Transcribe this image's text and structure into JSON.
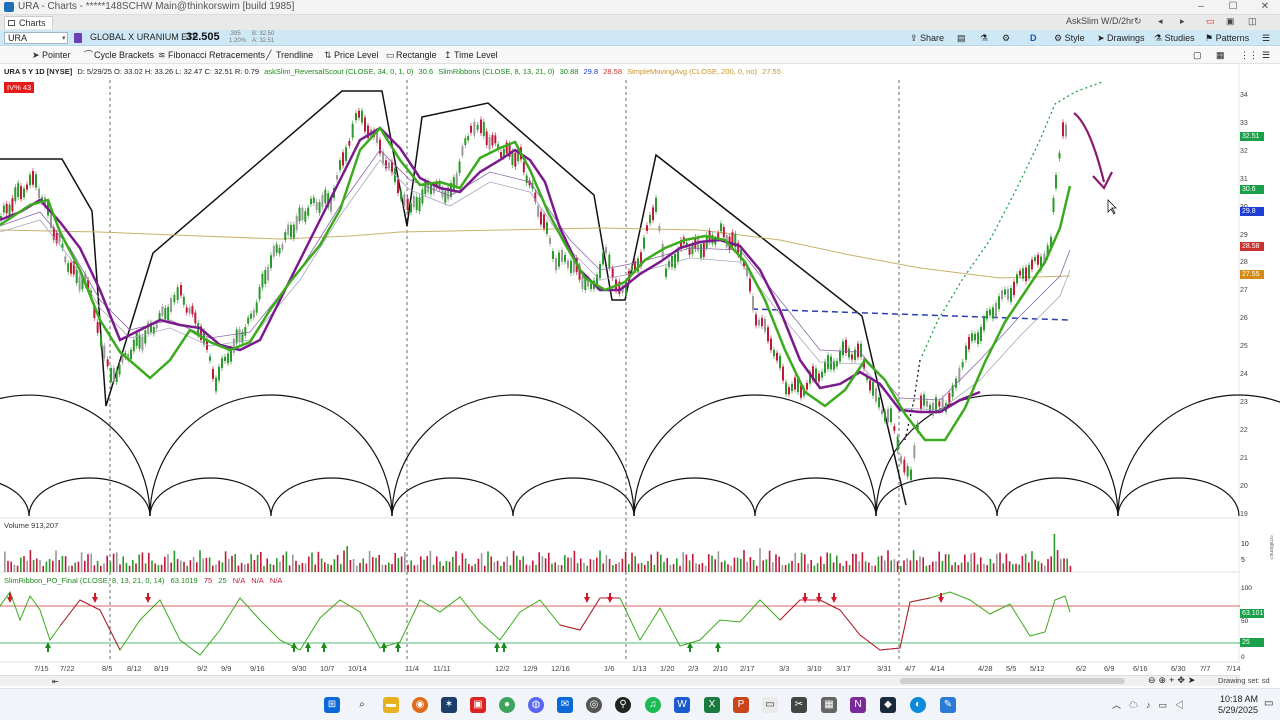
{
  "window": {
    "title": "URA - Charts - *****148SCHW Main@thinkorswim [build 1985]",
    "tab_label": "Charts",
    "right_account": "AskSlim W/D/2hr"
  },
  "symbol_bar": {
    "symbol": "URA",
    "description": "GLOBAL X URANIUM ETF",
    "last_price": "32.505",
    "change": ".395",
    "change_pct": "1.20%",
    "bid": "B: 32.50",
    "ask": "A: 32.51",
    "buttons": [
      "Share",
      "D",
      "Style",
      "Drawings",
      "Studies",
      "Patterns"
    ]
  },
  "toolbar": {
    "tools": [
      "Pointer",
      "Cycle Brackets",
      "Fibonacci Retracements",
      "Trendline",
      "Price Level",
      "Rectangle",
      "Time Level"
    ]
  },
  "study_header": {
    "symbol_info": "URA 5 Y 1D [NYSE]",
    "ohlc": "D: 5/29/25 O: 33.02 H: 33.26 L: 32.47 C: 32.51 R: 0.79",
    "study1": "askSlim_ReversalScout (CLOSE, 34, 0, 1, 0)",
    "study1_val": "30.6",
    "study2": "SlimRibbons (CLOSE, 8, 13, 21, 0)",
    "study2_vals": [
      "30.88",
      "29.8",
      "28.58"
    ],
    "study3": "SimpleMovingAvg (CLOSE, 200, 0, no)",
    "study3_val": "27.55",
    "iv_badge": "IV% 43"
  },
  "price_axis": {
    "ticks": [
      "34",
      "33",
      "32",
      "31",
      "30",
      "29",
      "28",
      "27",
      "26",
      "25",
      "24",
      "23",
      "22",
      "21",
      "20",
      "19"
    ],
    "tags": [
      {
        "label": "32.51",
        "color": "#1aa04a"
      },
      {
        "label": "30.6",
        "color": "#1aa04a"
      },
      {
        "label": "29.8",
        "color": "#1d3fd6"
      },
      {
        "label": "28.58",
        "color": "#c8322f"
      },
      {
        "label": "27.55",
        "color": "#d48a14"
      }
    ]
  },
  "volume_pane": {
    "label": "Volume",
    "value": "913,207",
    "axis_ticks": [
      "10",
      "5"
    ],
    "axis_unit": "<millions>"
  },
  "oscillator_pane": {
    "label": "SlimRibbon_PO_Final (CLOSE, 8, 13, 21, 0, 14)",
    "value": "63.1019",
    "levels": [
      "75",
      "25",
      "N/A",
      "N/A",
      "N/A"
    ],
    "axis_ticks": [
      "100",
      "75",
      "50",
      "25",
      "0"
    ],
    "tag": "63.1019",
    "tag2": "25"
  },
  "x_axis": {
    "labels": [
      "7/15",
      "7/22",
      "8/5",
      "8/12",
      "8/19",
      "9/2",
      "9/9",
      "9/16",
      "9/30",
      "10/7",
      "10/14",
      "11/4",
      "11/11",
      "12/2",
      "12/9",
      "12/16",
      "1/6",
      "1/13",
      "1/20",
      "2/3",
      "2/10",
      "2/17",
      "3/3",
      "3/10",
      "3/17",
      "3/31",
      "4/7",
      "4/14",
      "4/28",
      "5/5",
      "5/12",
      "6/2",
      "6/9",
      "6/16",
      "6/30",
      "7/7",
      "7/14"
    ]
  },
  "status": {
    "drawing_set": "Drawing set: sd"
  },
  "taskbar": {
    "time": "10:18 AM",
    "date": "5/29/2025"
  },
  "colors": {
    "up_candle": "#2a9a2a",
    "down_candle": "#c0173a",
    "ribbon_fast": "#3bab1d",
    "ribbon_slow": "#7a1a8c",
    "sma200": "#c8b26a",
    "symbol_bar_bg": "#cfe8f6"
  }
}
